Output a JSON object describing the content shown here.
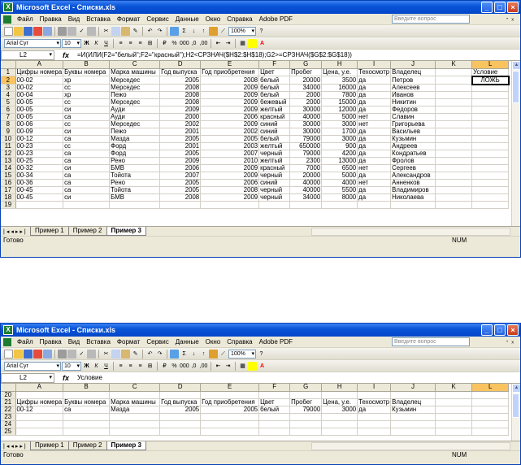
{
  "app": {
    "title": "Microsoft Excel - Списки.xls"
  },
  "menu": {
    "items": [
      "Файл",
      "Правка",
      "Вид",
      "Вставка",
      "Формат",
      "Сервис",
      "Данные",
      "Окно",
      "Справка",
      "Adobe PDF"
    ],
    "help_placeholder": "Введите вопрос"
  },
  "toolbar": {
    "zoom": "100%",
    "font": "Arial Cyr",
    "size": "10"
  },
  "columns": [
    "A",
    "B",
    "C",
    "D",
    "E",
    "F",
    "G",
    "H",
    "I",
    "J",
    "K",
    "L"
  ],
  "window1": {
    "namebox": "L2",
    "formula": "=И(ИЛИ(F2=\"белый\";F2=\"красный\");H2<СРЗНАЧ($H$2:$H$18);G2>=СРЗНАЧ($G$2:$G$18))",
    "header_row": [
      "Цифры номера",
      "Буквы номера",
      "Марка машины",
      "Год выпуска",
      "Год приобретения",
      "Цвет",
      "Пробег",
      "Цена, у.е.",
      "Техосмотр",
      "Владелец",
      "",
      "Условие"
    ],
    "rows": [
      [
        "00-02",
        "хр",
        "Мерседес",
        "2005",
        "2008",
        "белый",
        "20000",
        "3500",
        "да",
        "Петров",
        "",
        "ЛОЖЬ"
      ],
      [
        "00-02",
        "сс",
        "Мерседес",
        "2008",
        "2009",
        "белый",
        "34000",
        "16000",
        "да",
        "Алексеев",
        "",
        ""
      ],
      [
        "00-04",
        "хр",
        "Пежо",
        "2008",
        "2009",
        "белый",
        "2000",
        "7800",
        "да",
        "Иванов",
        "",
        ""
      ],
      [
        "00-05",
        "сс",
        "Мерседес",
        "2008",
        "2009",
        "бежевый",
        "2000",
        "15000",
        "да",
        "Никитин",
        "",
        ""
      ],
      [
        "00-05",
        "си",
        "Ауди",
        "2009",
        "2009",
        "желтый",
        "30000",
        "12000",
        "да",
        "Федоров",
        "",
        ""
      ],
      [
        "00-05",
        "са",
        "Ауди",
        "2000",
        "2006",
        "красный",
        "40000",
        "5000",
        "нет",
        "Славин",
        "",
        ""
      ],
      [
        "00-06",
        "сс",
        "Мерседес",
        "2002",
        "2009",
        "синий",
        "30000",
        "3000",
        "нет",
        "Григорьева",
        "",
        ""
      ],
      [
        "00-09",
        "си",
        "Пежо",
        "2001",
        "2002",
        "синий",
        "30000",
        "1700",
        "да",
        "Васильев",
        "",
        ""
      ],
      [
        "00-12",
        "са",
        "Мазда",
        "2005",
        "2005",
        "белый",
        "79000",
        "3000",
        "да",
        "Кузьмин",
        "",
        ""
      ],
      [
        "00-23",
        "сс",
        "Форд",
        "2001",
        "2003",
        "желтый",
        "650000",
        "900",
        "да",
        "Андреев",
        "",
        ""
      ],
      [
        "00-23",
        "са",
        "Форд",
        "2005",
        "2007",
        "черный",
        "79000",
        "4200",
        "да",
        "Кондратьев",
        "",
        ""
      ],
      [
        "00-25",
        "са",
        "Рено",
        "2009",
        "2010",
        "желтый",
        "2300",
        "13000",
        "да",
        "Фролов",
        "",
        ""
      ],
      [
        "00-32",
        "си",
        "БМВ",
        "2006",
        "2009",
        "красный",
        "7000",
        "6500",
        "нет",
        "Сергеев",
        "",
        ""
      ],
      [
        "00-34",
        "са",
        "Тойота",
        "2007",
        "2009",
        "черный",
        "20000",
        "5000",
        "да",
        "Александров",
        "",
        ""
      ],
      [
        "00-36",
        "са",
        "Рено",
        "2005",
        "2006",
        "синий",
        "40000",
        "4000",
        "нет",
        "Анненков",
        "",
        ""
      ],
      [
        "00-45",
        "са",
        "Тойота",
        "2005",
        "2008",
        "черный",
        "40000",
        "5500",
        "да",
        "Владимиров",
        "",
        ""
      ],
      [
        "00-45",
        "си",
        "БМВ",
        "2008",
        "2009",
        "черный",
        "34000",
        "8000",
        "да",
        "Николаева",
        "",
        ""
      ]
    ]
  },
  "window2": {
    "namebox": "L2",
    "formula": "Условие",
    "header_row": [
      "Цифры номера",
      "Буквы номера",
      "Марка машины",
      "Год выпуска",
      "Год приобретения",
      "Цвет",
      "Пробег",
      "Цена, у.е.",
      "Техосмотр",
      "Владелец",
      "",
      ""
    ],
    "rows": [
      [
        "00-12",
        "са",
        "Мазда",
        "2005",
        "2005",
        "белый",
        "79000",
        "3000",
        "да",
        "Кузьмин",
        "",
        ""
      ]
    ]
  },
  "sheets": [
    "Пример 1",
    "Пример 2",
    "Пример 3"
  ],
  "status": {
    "ready": "Готово",
    "num": "NUM"
  }
}
